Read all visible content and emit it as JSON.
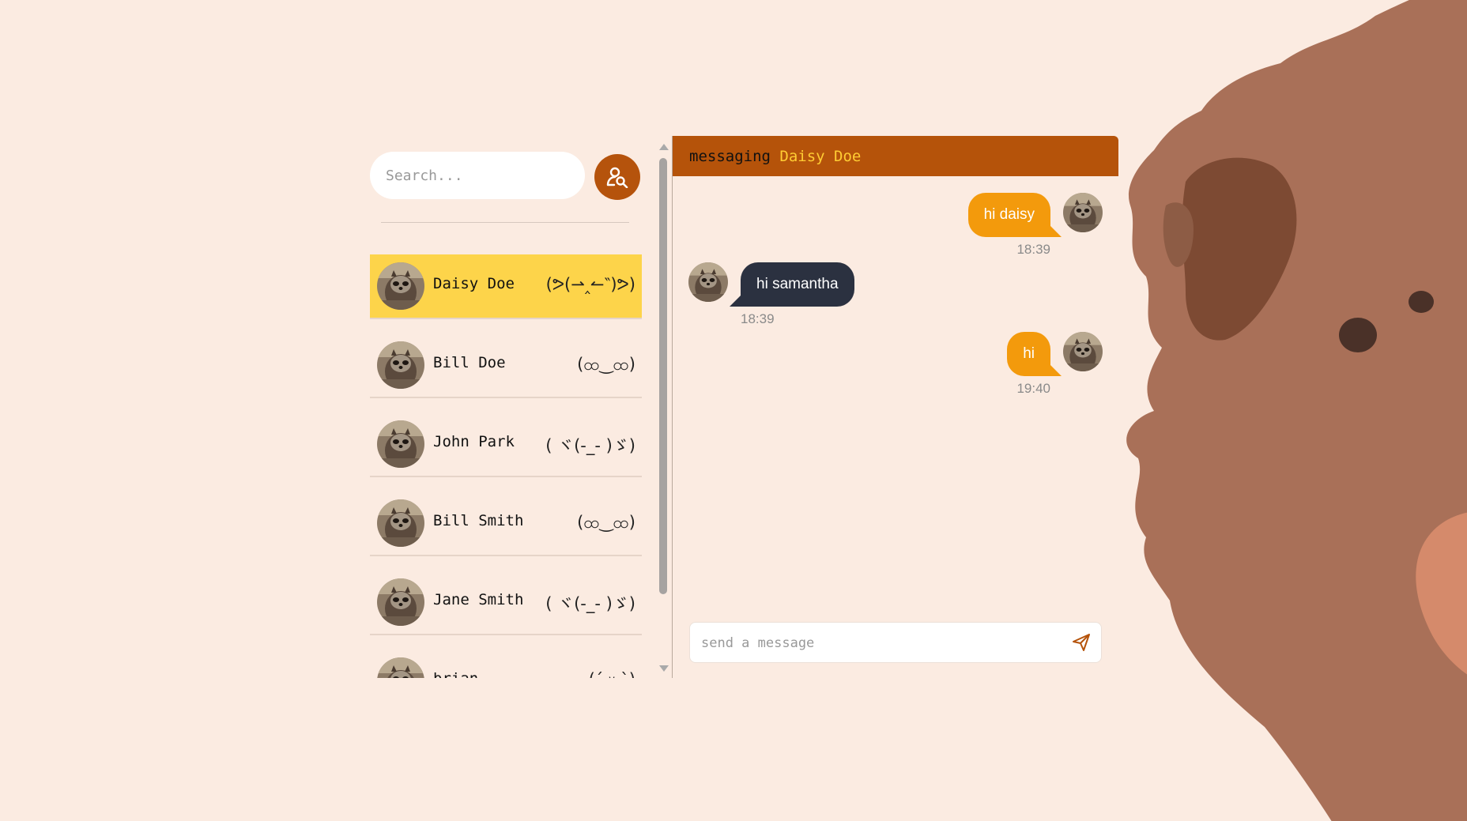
{
  "search": {
    "placeholder": "Search...",
    "button_icon": "user-search-icon"
  },
  "contacts": [
    {
      "name": "Daisy Doe",
      "mood": "(ᕗ(⇀‸↼‶)ᕗ)",
      "active": true
    },
    {
      "name": "Bill Doe",
      "mood": "(ထ‿ထ)",
      "active": false
    },
    {
      "name": "John Park",
      "mood": "( ヾ(-_- )ゞ)",
      "active": false
    },
    {
      "name": "Bill Smith",
      "mood": "(ထ‿ထ)",
      "active": false
    },
    {
      "name": "Jane Smith",
      "mood": "( ヾ(-_- )ゞ)",
      "active": false
    },
    {
      "name": "brian",
      "mood": "(ˊ ᵕ ˋ)",
      "active": false
    }
  ],
  "chat": {
    "header_prefix": "messaging",
    "contact_name": "Daisy Doe",
    "messages": [
      {
        "direction": "sent",
        "text": "hi daisy",
        "time": "18:39"
      },
      {
        "direction": "received",
        "text": "hi samantha",
        "time": "18:39"
      },
      {
        "direction": "sent",
        "text": "hi",
        "time": "19:40"
      }
    ],
    "composer_placeholder": "send a message",
    "send_icon": "send-icon"
  },
  "colors": {
    "background": "#fbebe1",
    "accent": "#b5530a",
    "active_contact": "#fdd44a",
    "sent_bubble": "#f39a0c",
    "received_bubble": "#2b3140",
    "header_name": "#ffcc33"
  }
}
